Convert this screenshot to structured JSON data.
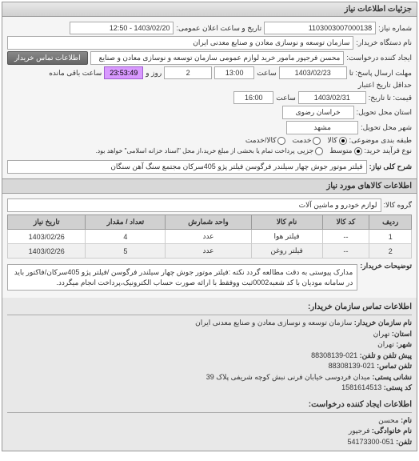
{
  "panel_title": "جزئیات اطلاعات نیاز",
  "fields": {
    "request_no_label": "شماره نیاز:",
    "request_no": "1103003007000138",
    "public_announce_label": "تاریخ و ساعت اعلان عمومی:",
    "public_announce": "1403/02/20 - 12:50",
    "buyer_org_label": "نام دستگاه خریدار:",
    "buyer_org": "سازمان توسعه و نوسازی معادن و صنایع معدنی ایران",
    "requester_label": "ایجاد کننده درخواست:",
    "requester": "محسن فرجپور مامور خرید لوازم عمومی سازمان توسعه و نوسازی معادن و صنایع",
    "buyer_contact_btn": "اطلاعات تماس خریدار",
    "deadline_to_label": "مهلت ارسال پاسخ: تا",
    "deadline_date": "1403/02/23",
    "deadline_time_label": "ساعت",
    "deadline_time": "13:00",
    "days_remain": "2",
    "days_remain_label": "روز و",
    "timer": "23:53:49",
    "timer_label": "ساعت باقی مانده",
    "validity_from_label": "حداقل تاریخ اعتبار",
    "validity_to_label": "قیمت: تا تاریخ:",
    "validity_date": "1403/02/31",
    "validity_time_label": "ساعت",
    "validity_time": "16:00",
    "delivery_province_label": "استان محل تحویل:",
    "delivery_province": "خراسان رضوی",
    "delivery_city_label": "شهر محل تحویل:",
    "delivery_city": "مشهد",
    "budget_cat_label": "طبقه بندی موضوعی:",
    "budget_options": [
      "کالا",
      "خدمت",
      "کالا/خدمت"
    ],
    "process_type_label": "نوع فرآیند خرید:",
    "process_options": [
      "متوسط",
      "جزیی"
    ],
    "process_note": "پرداخت تمام یا بخشی از مبلغ خرید،از محل \"اسناد خزانه اسلامی\" خواهد بود.",
    "need_desc_label": "شرح کلی نیاز:",
    "need_desc": "فیلتر موتور جوش چهار سیلندر فرگوسن فیلتر پژو 405سرکان مجتمع سنگ آهن سنگان"
  },
  "goods_section": "اطلاعات کالاهای مورد نیاز",
  "goods_group_label": "گروه کالا:",
  "goods_group": "لوازم خودرو و ماشین آلات",
  "table": {
    "headers": [
      "ردیف",
      "کد کالا",
      "نام کالا",
      "واحد شمارش",
      "تعداد / مقدار",
      "تاریخ نیاز"
    ],
    "rows": [
      [
        "1",
        "--",
        "فیلتر هوا",
        "عدد",
        "4",
        "1403/02/26"
      ],
      [
        "2",
        "--",
        "فیلتر روغن",
        "عدد",
        "5",
        "1403/02/26"
      ]
    ]
  },
  "buyer_notes_label": "توضیحات خریدار:",
  "buyer_notes": "مدارک پیوستی به دقت مطالعه گردد نکته :فیلتر موتور جوش چهار سیلندر فرگوسن /فیلتر پژو 405سرکان/فاکتور باید در سامانه مودیان با کد شعبه0002ثبت ووفقط با ارائه صورت حساب الکترونیک،پرداخت انجام میگردد.",
  "buyer_contact_header": "اطلاعات تماس سازمان خریدار:",
  "buyer_contact": {
    "org_label": "نام سازمان خریدار:",
    "org": "سازمان توسعه و نوسازی معادن و صنایع معدنی ایران",
    "province_label": "استان:",
    "province": "تهران",
    "city_label": "شهر:",
    "city": "تهران",
    "phone_label": "پیش تلفن و تلفن:",
    "phone": "021-88308139",
    "fax_label": "تلفن تماس:",
    "fax": "021-88308139",
    "postal_label": "نشانی پستی:",
    "postal": "میدان فردوسی خیابان فرنی نبش کوچه شریفی پلاک 39",
    "zip_label": "کد پستی:",
    "zip": "1581614513"
  },
  "requester_contact_header": "اطلاعات ایجاد کننده درخواست:",
  "requester_contact": {
    "fname_label": "نام:",
    "fname": "محسن",
    "lname_label": "نام خانوادگی:",
    "lname": "فرجپور",
    "phone_label": "تلفن:",
    "phone": "051-54173300"
  }
}
